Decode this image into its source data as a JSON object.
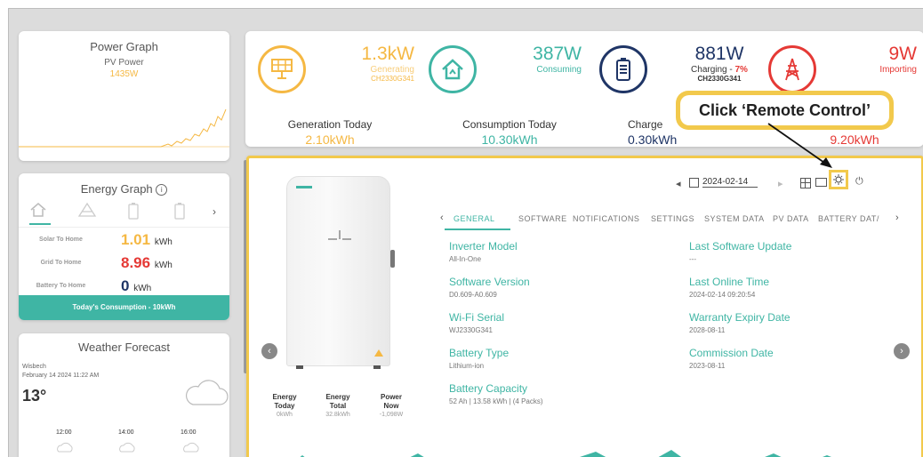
{
  "power_graph": {
    "title": "Power Graph",
    "subtitle": "PV Power",
    "value": "1435W"
  },
  "stats": {
    "generating": {
      "value": "1.3kW",
      "label": "Generating",
      "serial": "CH2330G341"
    },
    "consuming": {
      "value": "387W",
      "label": "Consuming"
    },
    "battery": {
      "value": "881W",
      "label_prefix": "Charging - ",
      "percent": "7%",
      "serial": "CH2330G341"
    },
    "grid": {
      "value": "9W",
      "label": "Importing"
    },
    "generation_today": {
      "label": "Generation Today",
      "value": "2.10kWh"
    },
    "consumption_today": {
      "label": "Consumption Today",
      "value": "10.30kWh"
    },
    "charge_today": {
      "label": "Charge",
      "value": "0.30kWh"
    },
    "import_today": {
      "value": "9.20kWh"
    }
  },
  "energy_graph": {
    "title": "Energy Graph",
    "rows": [
      {
        "label": "Solar To Home",
        "value": "1.01",
        "unit": "kWh",
        "color": "#f5b843"
      },
      {
        "label": "Grid To Home",
        "value": "8.96",
        "unit": "kWh",
        "color": "#e53935"
      },
      {
        "label": "Battery To Home",
        "value": "0",
        "unit": "kWh",
        "color": "#1f3566"
      }
    ],
    "footer": "Today's Consumption - 10kWh"
  },
  "weather": {
    "title": "Weather Forecast",
    "location": "Wisbech",
    "datetime": "February 14 2024 11:22 AM",
    "temp": "13°",
    "hours": [
      "12:00",
      "14:00",
      "16:00"
    ]
  },
  "device": {
    "date": "2024-02-14",
    "tabs": [
      "GENERAL",
      "SOFTWARE",
      "NOTIFICATIONS",
      "SETTINGS",
      "SYSTEM DATA",
      "PV DATA",
      "BATTERY DAT/"
    ],
    "left_info": [
      {
        "label": "Inverter Model",
        "value": "All-In-One"
      },
      {
        "label": "Software Version",
        "value": "D0.609-A0.609"
      },
      {
        "label": "Wi-Fi Serial",
        "value": "WJ2330G341"
      },
      {
        "label": "Battery Type",
        "value": "Lithium-ion"
      },
      {
        "label": "Battery Capacity",
        "value": "52 Ah | 13.58 kWh | (4 Packs)"
      }
    ],
    "right_info": [
      {
        "label": "Last Software Update",
        "value": "---"
      },
      {
        "label": "Last Online Time",
        "value": "2024-02-14 09:20:54"
      },
      {
        "label": "Warranty Expiry Date",
        "value": "2028-08-11"
      },
      {
        "label": "Commission Date",
        "value": "2023-08-11"
      }
    ],
    "summary": [
      {
        "label1": "Energy",
        "label2": "Today",
        "value": "0kWh"
      },
      {
        "label1": "Energy",
        "label2": "Total",
        "value": "32.8kWh"
      },
      {
        "label1": "Power",
        "label2": "Now",
        "value": "-1,098W"
      }
    ]
  },
  "callout": "Click ‘Remote Control’",
  "colors": {
    "accent": "#3fb5a4",
    "highlight": "#f2c94c",
    "solar": "#f5b843",
    "grid": "#e53935",
    "battery": "#1f3566"
  }
}
